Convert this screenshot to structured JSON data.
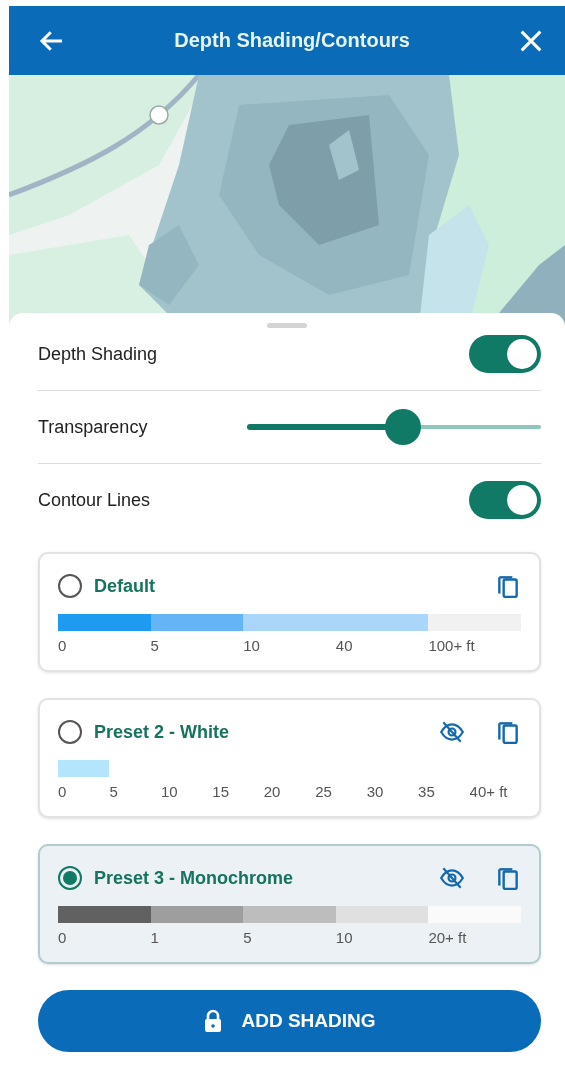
{
  "header": {
    "title": "Depth Shading/Contours"
  },
  "settings": [
    {
      "kind": "toggle",
      "label": "Depth Shading",
      "on": true
    },
    {
      "kind": "slider",
      "label": "Transparency",
      "level": 0.53
    },
    {
      "kind": "toggle",
      "label": "Contour Lines",
      "on": true
    }
  ],
  "presets": [
    {
      "name": "Default",
      "selected": false,
      "hidden": false,
      "segments": [
        {
          "color": "#1e9bf0"
        },
        {
          "color": "#64b5f6"
        },
        {
          "color": "#aad6fa"
        },
        {
          "color": "#aad6fa"
        },
        {
          "color": "#f1f1f1"
        }
      ],
      "ticks": [
        "0",
        "5",
        "10",
        "40",
        "100+ ft"
      ]
    },
    {
      "name": "Preset 2 - White",
      "selected": false,
      "hidden": true,
      "segments": [
        {
          "color": "#b3e5fc"
        }
      ],
      "ticks": [
        "0",
        "5",
        "10",
        "15",
        "20",
        "25",
        "30",
        "35",
        "40+ ft"
      ]
    },
    {
      "name": "Preset 3 - Monochrome",
      "selected": true,
      "hidden": true,
      "segments": [
        {
          "color": "#616161"
        },
        {
          "color": "#9e9e9e"
        },
        {
          "color": "#bdbdbd"
        },
        {
          "color": "#e0e0e0"
        },
        {
          "color": "#fafafa"
        }
      ],
      "ticks": [
        "0",
        "1",
        "5",
        "10",
        "20+ ft"
      ]
    }
  ],
  "button": {
    "label": "ADD SHADING",
    "locked": true
  }
}
